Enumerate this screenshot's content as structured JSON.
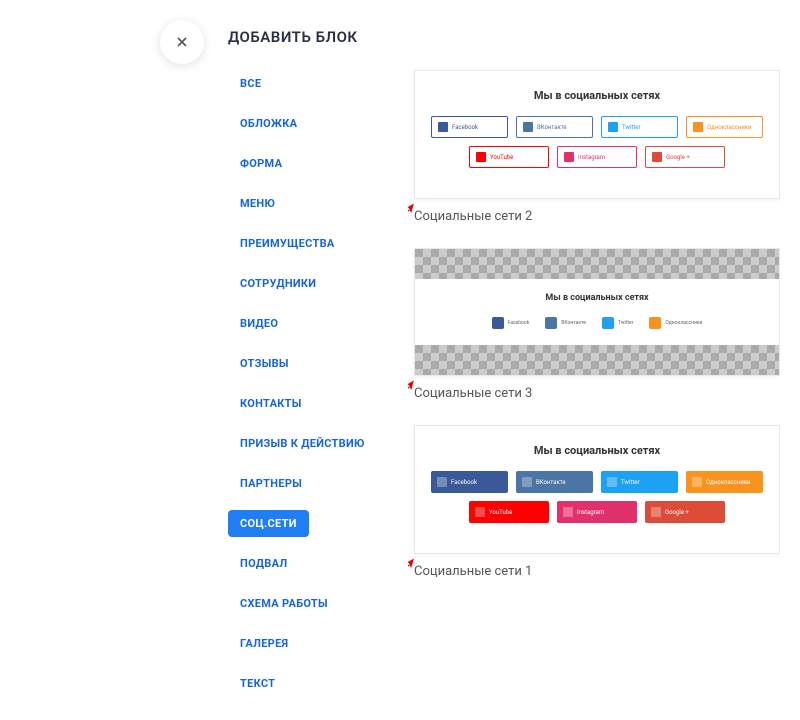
{
  "modal": {
    "title": "ДОБАВИТЬ БЛОК"
  },
  "sidebar": {
    "items": [
      {
        "label": "ВСЕ"
      },
      {
        "label": "ОБЛОЖКА"
      },
      {
        "label": "ФОРМА"
      },
      {
        "label": "МЕНЮ"
      },
      {
        "label": "ПРЕИМУЩЕСТВА"
      },
      {
        "label": "СОТРУДНИКИ"
      },
      {
        "label": "ВИДЕО"
      },
      {
        "label": "ОТЗЫВЫ"
      },
      {
        "label": "КОНТАКТЫ"
      },
      {
        "label": "ПРИЗЫВ К ДЕЙСТВИЮ"
      },
      {
        "label": "ПАРТНЕРЫ"
      },
      {
        "label": "СОЦ.СЕТИ",
        "active": true
      },
      {
        "label": "ПОДВАЛ"
      },
      {
        "label": "СХЕМА РАБОТЫ"
      },
      {
        "label": "ГАЛЕРЕЯ"
      },
      {
        "label": "ТЕКСТ"
      }
    ]
  },
  "preview_common": {
    "heading": "Мы в социальных сетях",
    "socials": {
      "fb": "Facebook",
      "vk": "ВКонтакте",
      "tw": "Twitter",
      "ok": "Одноклассники",
      "yt": "YouTube",
      "ig": "Instagram",
      "gp": "Google +"
    }
  },
  "blocks": [
    {
      "label": "Социальные сети 2"
    },
    {
      "label": "Социальные сети 3"
    },
    {
      "label": "Социальные сети 1"
    }
  ]
}
